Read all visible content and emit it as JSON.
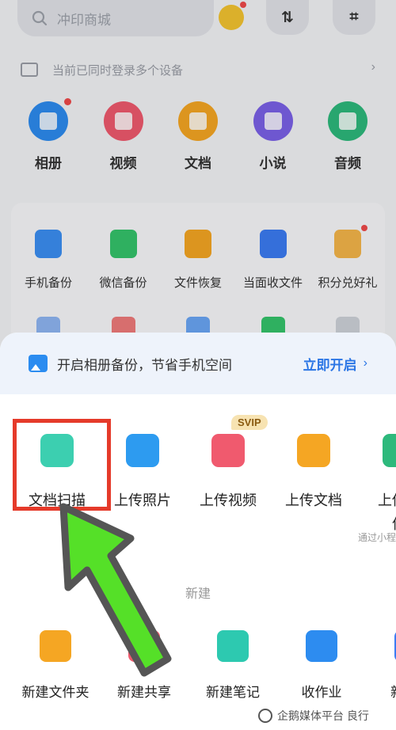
{
  "search": {
    "placeholder": "冲印商城"
  },
  "header_buttons": {
    "sort_glyph": "⇅",
    "scan_glyph": "⌗"
  },
  "devices": {
    "text": "当前已同时登录多个设备",
    "chevron": "›"
  },
  "categories": [
    {
      "label": "相册",
      "icon": "photo-album-icon",
      "color": "#2d8cf0",
      "badge": true
    },
    {
      "label": "视频",
      "icon": "video-icon",
      "color": "#f05a6e",
      "badge": false
    },
    {
      "label": "文档",
      "icon": "document-icon",
      "color": "#f5a623",
      "badge": false
    },
    {
      "label": "小说",
      "icon": "book-icon",
      "color": "#7b61e8",
      "badge": false
    },
    {
      "label": "音频",
      "icon": "audio-icon",
      "color": "#2db97c",
      "badge": false
    }
  ],
  "tools": [
    {
      "label": "手机备份",
      "icon": "phone-backup-icon",
      "color": "#3b8ff3",
      "badge": false
    },
    {
      "label": "微信备份",
      "icon": "wechat-backup-icon",
      "color": "#35c46b",
      "badge": false
    },
    {
      "label": "文件恢复",
      "icon": "file-restore-icon",
      "color": "#f5a623",
      "badge": false
    },
    {
      "label": "当面收文件",
      "icon": "receive-file-icon",
      "color": "#3b7cf3",
      "badge": false
    },
    {
      "label": "积分兑好礼",
      "icon": "gift-icon",
      "color": "#f5b64a",
      "badge": true
    }
  ],
  "promo": {
    "text": "开启相册备份，节省手机空间",
    "cta": "立即开启",
    "cta_arrow": "›"
  },
  "actions": [
    {
      "label": "文档扫描",
      "icon": "document-scan-icon",
      "color": "#3ccfb0"
    },
    {
      "label": "上传照片",
      "icon": "upload-photo-icon",
      "color": "#2d9bf0"
    },
    {
      "label": "上传视频",
      "icon": "upload-video-icon",
      "color": "#f05a6e"
    },
    {
      "label": "上传文档",
      "icon": "upload-document-icon",
      "color": "#f5a623"
    },
    {
      "label": "上传微",
      "sub": "件",
      "icon": "upload-wechat-icon",
      "color": "#2db97c"
    }
  ],
  "svip_badge": "SVIP",
  "wechat_note": "通过小程",
  "section_new": "新建",
  "new_items": [
    {
      "label": "新建文件夹",
      "icon": "new-folder-icon",
      "color": "#f5a623"
    },
    {
      "label": "新建共享",
      "icon": "new-share-icon",
      "color": "#f05a6e"
    },
    {
      "label": "新建笔记",
      "icon": "new-note-icon",
      "color": "#2dc9b0"
    },
    {
      "label": "收作业",
      "icon": "collect-homework-icon",
      "color": "#2d8cf0"
    },
    {
      "label": "新建W",
      "icon": "new-word-icon",
      "color": "#3b7cf3"
    }
  ],
  "watermark": "企鹅媒体平台 良行",
  "colors": {
    "highlight": "#e53a2a",
    "arrow": "#55e028",
    "accent": "#2b76e5"
  }
}
